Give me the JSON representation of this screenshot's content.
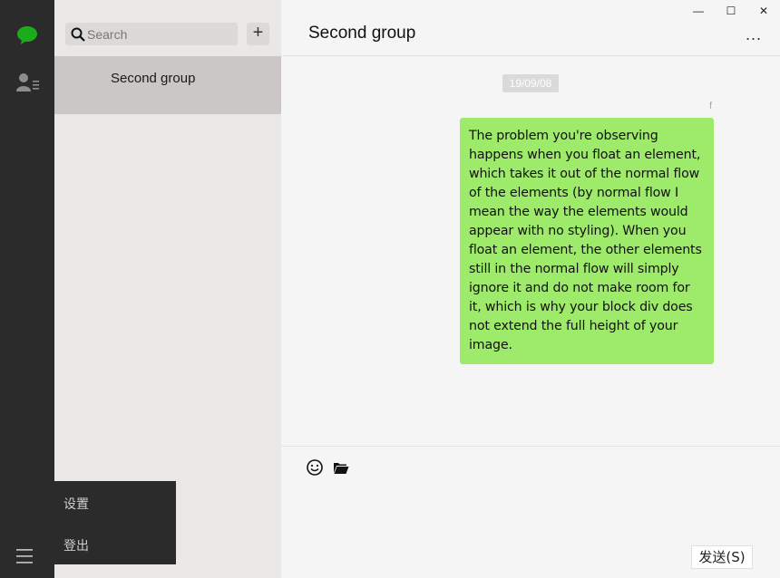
{
  "rail": {
    "icons": [
      "chat-icon",
      "contacts-icon",
      "menu-icon"
    ],
    "active_color": "#1aad19"
  },
  "list": {
    "search_placeholder": "Search",
    "add_label": "+",
    "conversations": [
      {
        "name": "Second group"
      }
    ]
  },
  "popup_menu": {
    "items": [
      "设置",
      "登出"
    ]
  },
  "window": {
    "minimize": "—",
    "maximize": "☐",
    "close": "✕"
  },
  "chat": {
    "title": "Second group",
    "more_label": "...",
    "messages": [
      {
        "time": "19/09/08",
        "sender": "f",
        "text": "The problem you're observing happens when you float an element, which takes it out of the normal flow of the elements (by normal flow I mean the way the elements would appear with no styling). When you float an element, the other elements still in the normal flow will simply ignore it and do not make room for it, which is why your block div does not extend the full height of your image.",
        "bubble_color": "#9eea6a"
      }
    ],
    "composer": {
      "icons": [
        "emoji-icon",
        "folder-icon"
      ],
      "input_value": "",
      "send_label": "发送(S)"
    }
  }
}
